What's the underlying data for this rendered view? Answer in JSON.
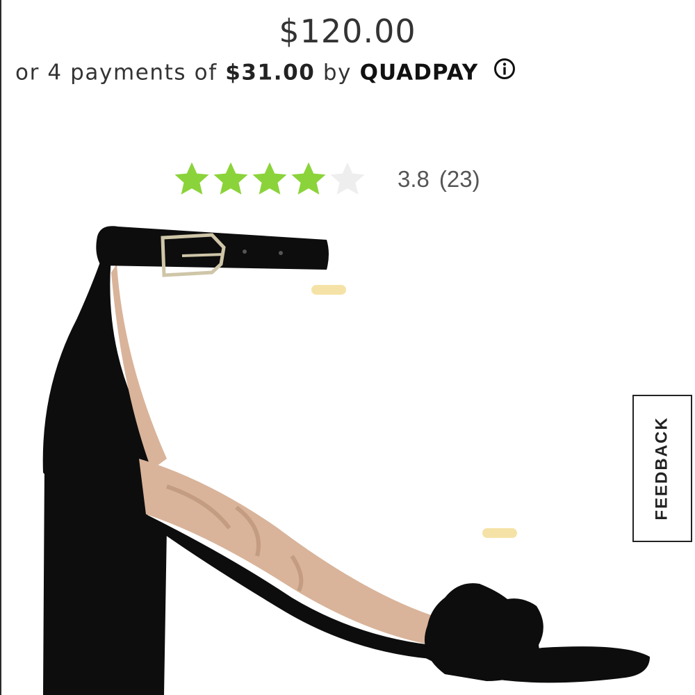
{
  "product": {
    "price": "$120.00",
    "installments": {
      "prefix": "or 4 payments of",
      "amount": "$31.00",
      "by": "by",
      "provider": "QUADPAY"
    },
    "rating": {
      "stars_filled": 3.8,
      "stars_total": 5,
      "value": "3.8",
      "count": "(23)"
    },
    "image_subject": "black suede block-heel ankle-strap sandal"
  },
  "feedback_tab": {
    "label": "FEEDBACK"
  },
  "colors": {
    "star_filled": "#8bd33a",
    "star_empty": "#eeeeee",
    "text": "#333333",
    "shoe": "#0d0d0d",
    "insole": "#d9b49a",
    "buckle": "#cfc6a8"
  },
  "icons": {
    "info": "info-circle-icon",
    "star": "star-icon"
  }
}
